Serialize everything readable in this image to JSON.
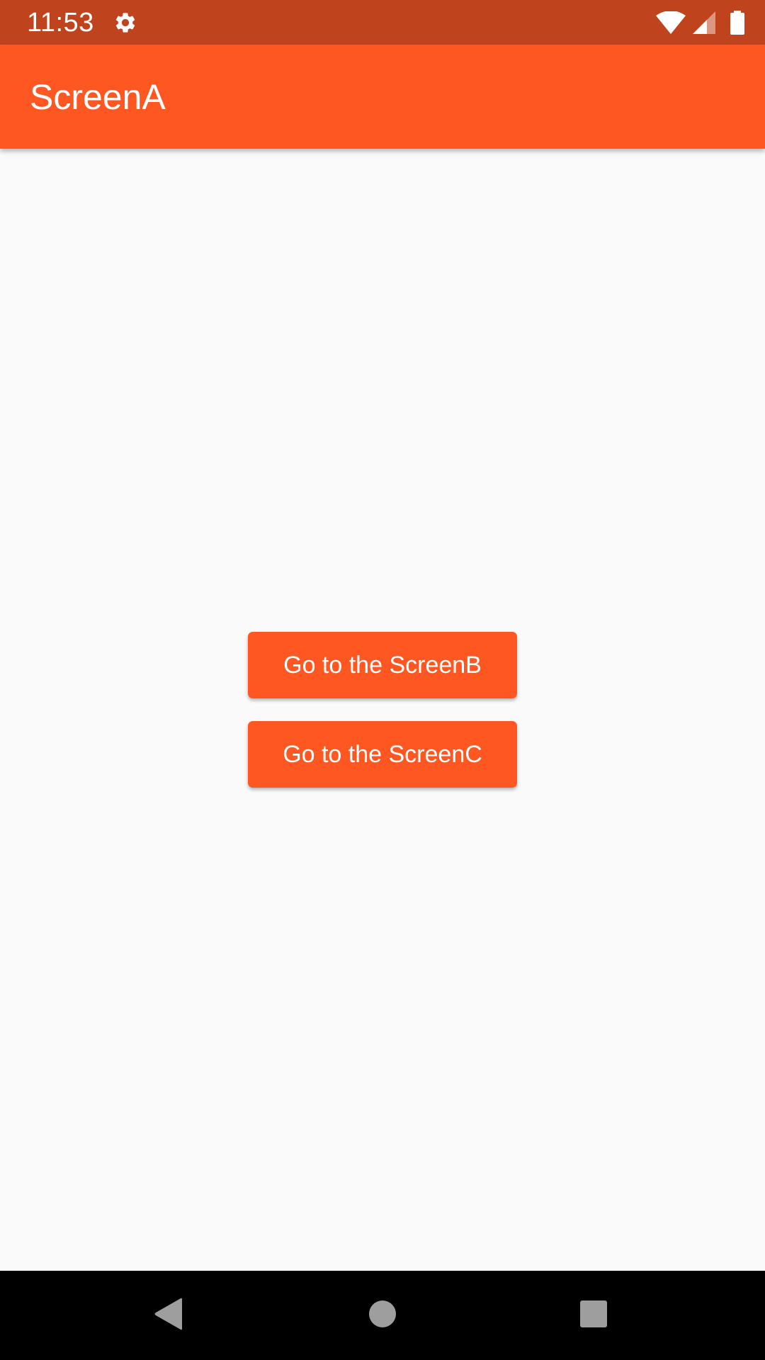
{
  "status_bar": {
    "time": "11:53",
    "background": "#bf431d",
    "icons": [
      "gear-icon",
      "wifi-icon",
      "signal-icon",
      "battery-icon"
    ]
  },
  "app_bar": {
    "title": "ScreenA",
    "background": "#ff5722"
  },
  "content": {
    "buttons": [
      {
        "label": "Go to the ScreenB"
      },
      {
        "label": "Go to the ScreenC"
      }
    ],
    "button_color": "#ff5722"
  },
  "nav_bar": {
    "icons": [
      "back-icon",
      "home-icon",
      "recents-icon"
    ]
  }
}
